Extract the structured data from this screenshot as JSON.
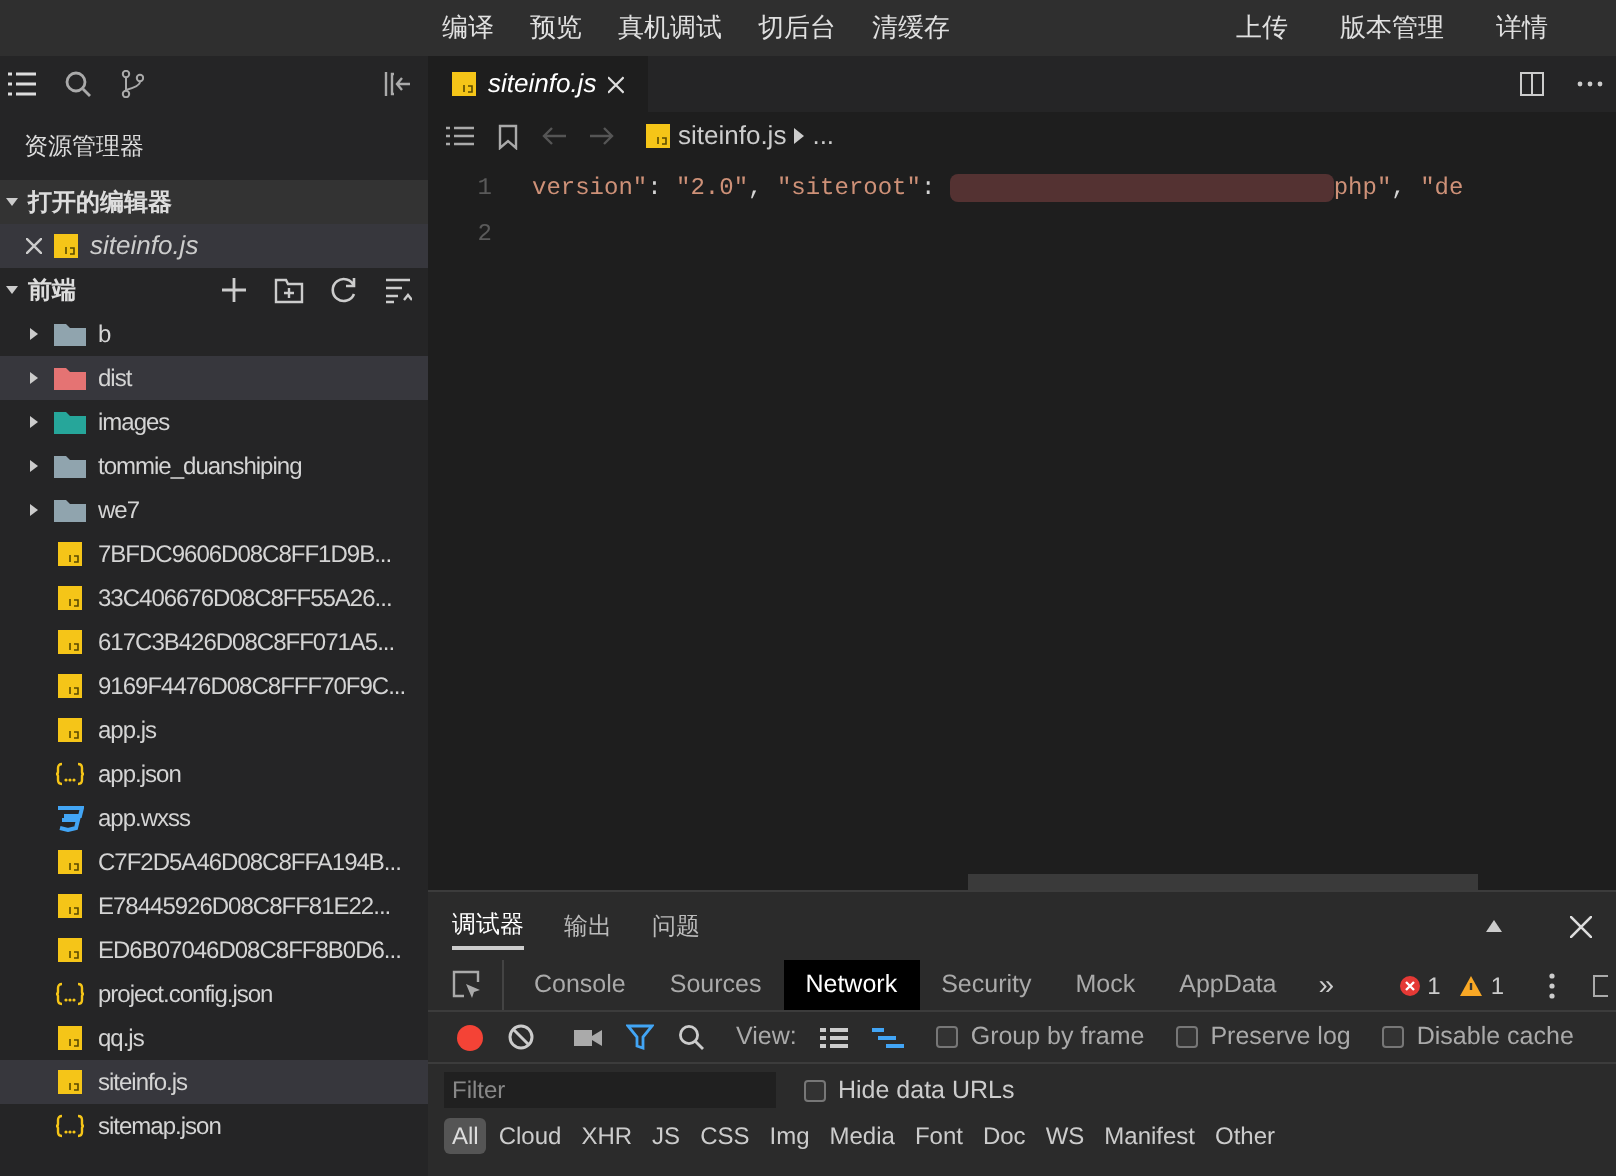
{
  "toolbar": {
    "left": [
      "编译",
      "预览",
      "真机调试",
      "切后台",
      "清缓存"
    ],
    "right": [
      "上传",
      "版本管理",
      "详情"
    ]
  },
  "sidebar": {
    "title": "资源管理器",
    "open_editors": {
      "label": "打开的编辑器",
      "expanded": true,
      "files": [
        {
          "name": "siteinfo.js",
          "kind": "js"
        }
      ]
    },
    "project": {
      "label": "前端",
      "expanded": true,
      "items": [
        {
          "name": "b",
          "kind": "folder",
          "color": "#90a4ae",
          "selected": false
        },
        {
          "name": "dist",
          "kind": "folder",
          "color": "#e57373",
          "selected": true
        },
        {
          "name": "images",
          "kind": "folder",
          "color": "#26a69a",
          "selected": false
        },
        {
          "name": "tommie_duanshiping",
          "kind": "folder",
          "color": "#90a4ae",
          "selected": false
        },
        {
          "name": "we7",
          "kind": "folder",
          "color": "#90a4ae",
          "selected": false
        },
        {
          "name": "7BFDC9606D08C8FF1D9B...",
          "kind": "js",
          "selected": false
        },
        {
          "name": "33C406676D08C8FF55A26...",
          "kind": "js",
          "selected": false
        },
        {
          "name": "617C3B426D08C8FF071A5...",
          "kind": "js",
          "selected": false
        },
        {
          "name": "9169F4476D08C8FFF70F9C...",
          "kind": "js",
          "selected": false
        },
        {
          "name": "app.js",
          "kind": "js",
          "selected": false
        },
        {
          "name": "app.json",
          "kind": "json",
          "selected": false
        },
        {
          "name": "app.wxss",
          "kind": "css",
          "selected": false
        },
        {
          "name": "C7F2D5A46D08C8FFA194B...",
          "kind": "js",
          "selected": false
        },
        {
          "name": "E78445926D08C8FF81E22...",
          "kind": "js",
          "selected": false
        },
        {
          "name": "ED6B07046D08C8FF8B0D6...",
          "kind": "js",
          "selected": false
        },
        {
          "name": "project.config.json",
          "kind": "json",
          "selected": false
        },
        {
          "name": "qq.js",
          "kind": "js",
          "selected": false
        },
        {
          "name": "siteinfo.js",
          "kind": "js",
          "selected": true
        },
        {
          "name": "sitemap.json",
          "kind": "json",
          "selected": false
        }
      ]
    }
  },
  "editor": {
    "tab": "siteinfo.js",
    "breadcrumb": [
      "siteinfo.js",
      "..."
    ],
    "lines": [
      {
        "number": "1",
        "tokens": [
          {
            "kind": "string",
            "text": "version\""
          },
          {
            "kind": "plain",
            "text": ": "
          },
          {
            "kind": "string",
            "text": "\"2.0\""
          },
          {
            "kind": "plain",
            "text": ", "
          },
          {
            "kind": "string",
            "text": "\"siteroot\""
          },
          {
            "kind": "plain",
            "text": ": "
          },
          {
            "kind": "redacted"
          },
          {
            "kind": "string",
            "text": "php\""
          },
          {
            "kind": "plain",
            "text": ", "
          },
          {
            "kind": "string",
            "text": "\"de"
          }
        ]
      },
      {
        "number": "2"
      }
    ]
  },
  "debug_panel": {
    "tabs": [
      {
        "label": "调试器",
        "selected": true
      },
      {
        "label": "输出",
        "selected": false
      },
      {
        "label": "问题",
        "selected": false
      }
    ],
    "devtools_tabs": [
      {
        "label": "Console",
        "selected": false
      },
      {
        "label": "Sources",
        "selected": false
      },
      {
        "label": "Network",
        "selected": true
      },
      {
        "label": "Security",
        "selected": false
      },
      {
        "label": "Mock",
        "selected": false
      },
      {
        "label": "AppData",
        "selected": false
      }
    ],
    "more": "»",
    "errors": "1",
    "warnings": "1",
    "recording": true,
    "view_label": "View:",
    "options": [
      {
        "label": "Group by frame",
        "checked": false
      },
      {
        "label": "Preserve log",
        "checked": false
      },
      {
        "label": "Disable cache",
        "checked": false
      }
    ],
    "filter": {
      "placeholder": "Filter"
    },
    "hide_data_urls": {
      "label": "Hide data URLs",
      "checked": false
    },
    "types": [
      {
        "label": "All",
        "selected": true
      },
      {
        "label": "Cloud",
        "selected": false
      },
      {
        "label": "XHR",
        "selected": false
      },
      {
        "label": "JS",
        "selected": false
      },
      {
        "label": "CSS",
        "selected": false
      },
      {
        "label": "Img",
        "selected": false
      },
      {
        "label": "Media",
        "selected": false
      },
      {
        "label": "Font",
        "selected": false
      },
      {
        "label": "Doc",
        "selected": false
      },
      {
        "label": "WS",
        "selected": false
      },
      {
        "label": "Manifest",
        "selected": false
      },
      {
        "label": "Other",
        "selected": false
      }
    ]
  }
}
